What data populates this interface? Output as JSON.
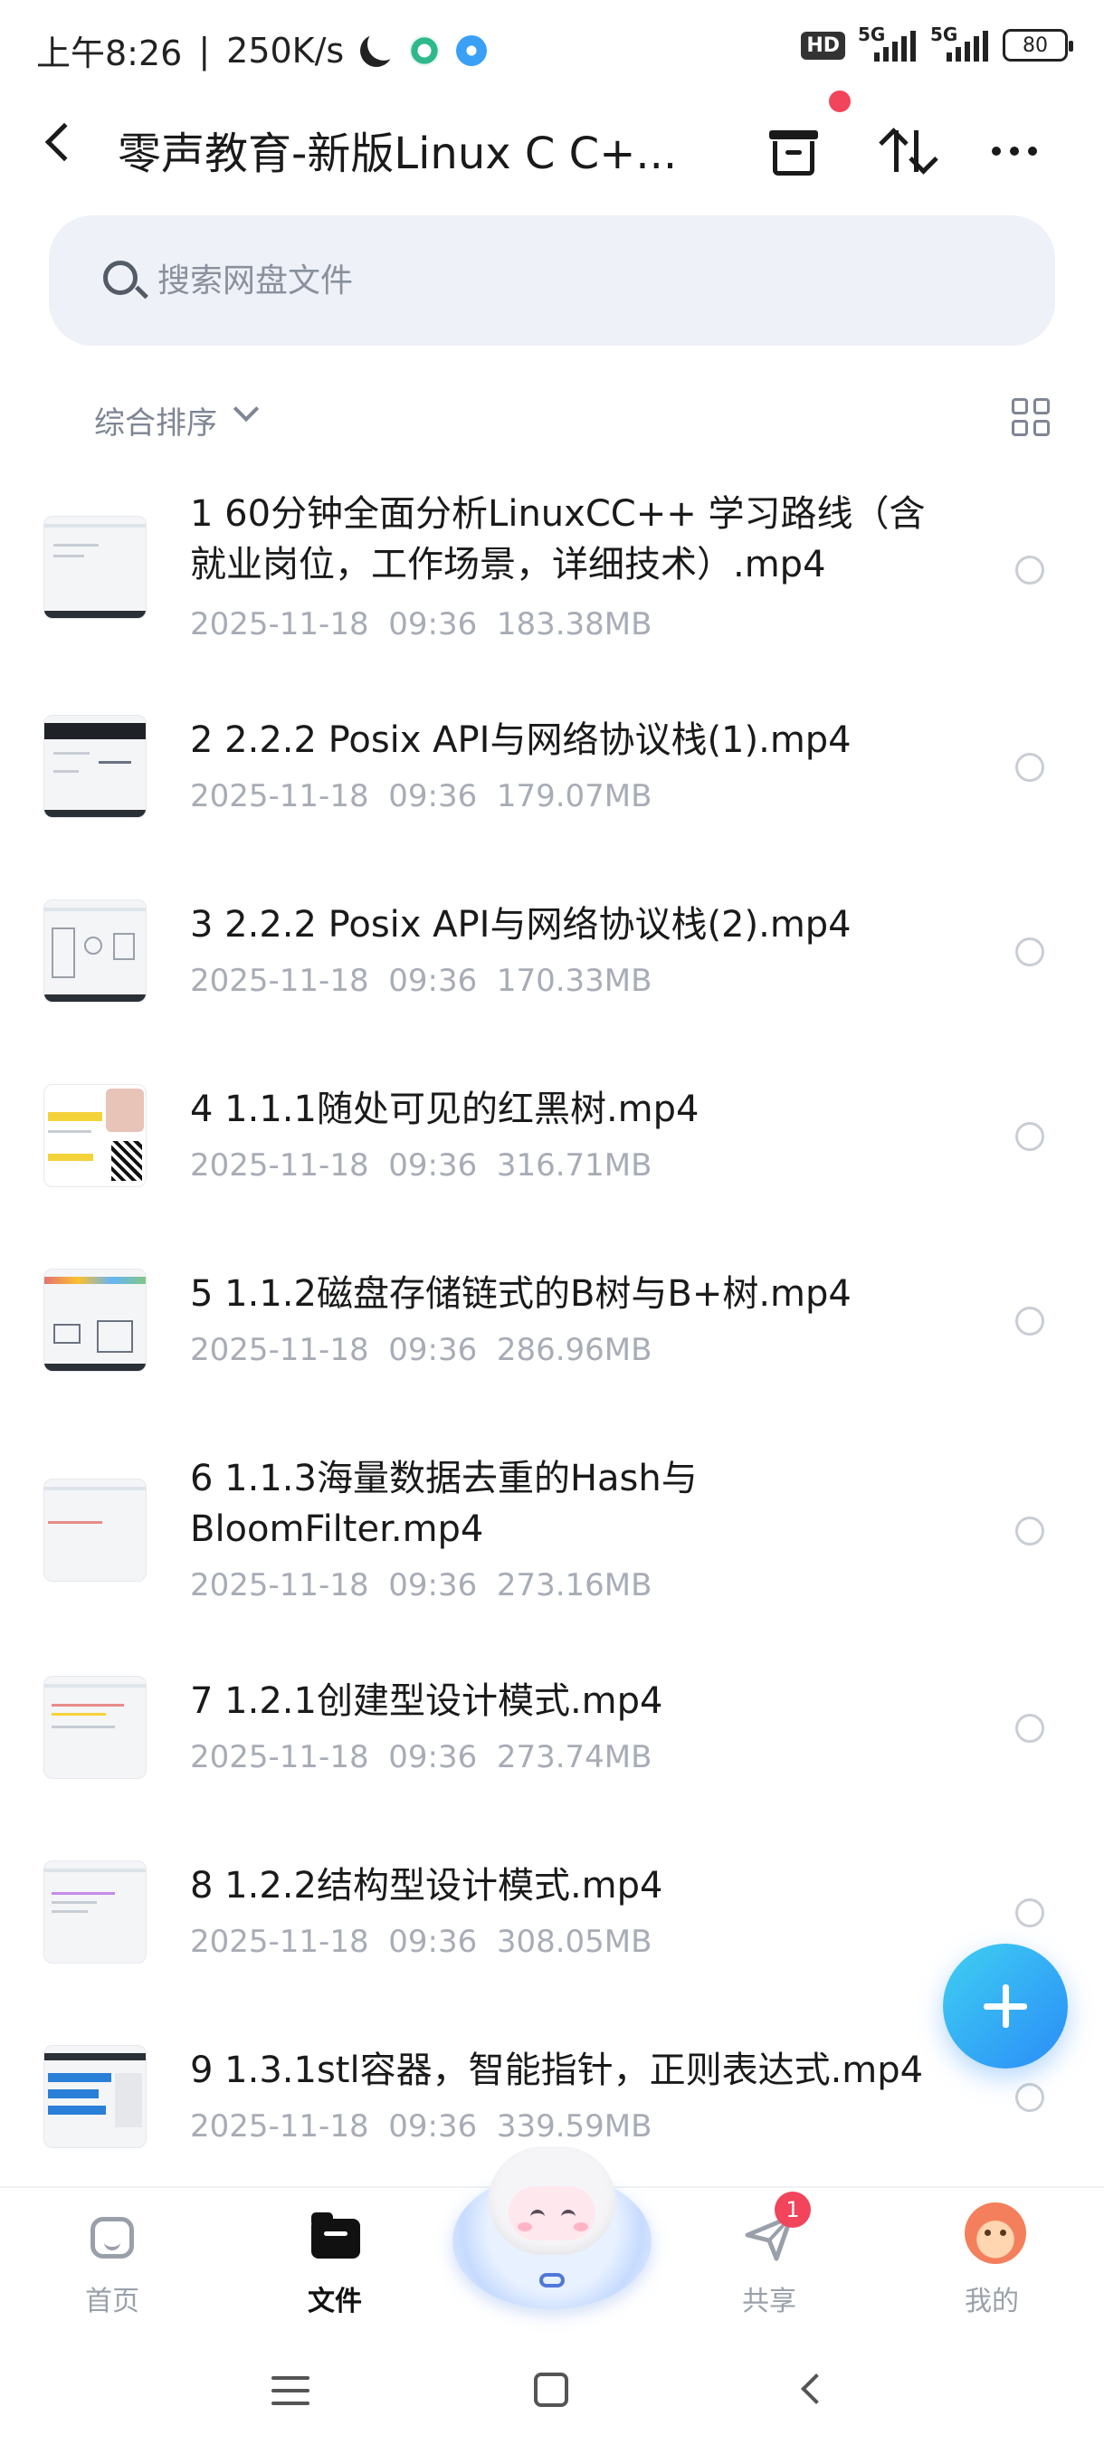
{
  "status_bar": {
    "time": "上午8:26",
    "speed": "250K/s",
    "hd": "HD",
    "network_1": "5G",
    "network_2": "5G",
    "battery": "80"
  },
  "nav": {
    "title": "零声教育-新版Linux C C+...",
    "back_icon": "back-arrow-icon",
    "archive_icon": "archive-box-icon",
    "sort_icon": "sort-arrows-icon",
    "more_icon": "more-dots-icon"
  },
  "search": {
    "placeholder": "搜索网盘文件",
    "value": ""
  },
  "sort": {
    "label": "综合排序"
  },
  "files": [
    {
      "name": "1 60分钟全面分析LinuxCC++ 学习路线（含就业岗位，工作场景，详细技术）.mp4",
      "date": "2025-11-18",
      "time": "09:36",
      "size": "183.38MB"
    },
    {
      "name": "2 2.2.2 Posix API与网络协议栈(1).mp4",
      "date": "2025-11-18",
      "time": "09:36",
      "size": "179.07MB"
    },
    {
      "name": "3 2.2.2 Posix API与网络协议栈(2).mp4",
      "date": "2025-11-18",
      "time": "09:36",
      "size": "170.33MB"
    },
    {
      "name": "4 1.1.1随处可见的红黑树.mp4",
      "date": "2025-11-18",
      "time": "09:36",
      "size": "316.71MB"
    },
    {
      "name": "5 1.1.2磁盘存储链式的B树与B+树.mp4",
      "date": "2025-11-18",
      "time": "09:36",
      "size": "286.96MB"
    },
    {
      "name": "6 1.1.3海量数据去重的Hash与BloomFilter.mp4",
      "date": "2025-11-18",
      "time": "09:36",
      "size": "273.16MB"
    },
    {
      "name": "7 1.2.1创建型设计模式.mp4",
      "date": "2025-11-18",
      "time": "09:36",
      "size": "273.74MB"
    },
    {
      "name": "8 1.2.2结构型设计模式.mp4",
      "date": "2025-11-18",
      "time": "09:36",
      "size": "308.05MB"
    },
    {
      "name": "9 1.3.1stl容器，智能指针，正则表达式.mp4",
      "date": "2025-11-18",
      "time": "09:36",
      "size": "339.59MB"
    }
  ],
  "tabs": [
    {
      "label": "首页",
      "icon": "home-icon"
    },
    {
      "label": "文件",
      "icon": "folder-icon"
    },
    {
      "label": "共享",
      "icon": "send-plane-icon",
      "badge": "1"
    },
    {
      "label": "我的",
      "icon": "avatar-icon"
    }
  ],
  "colors": {
    "accent": "#2a8cf7",
    "badge": "#f2445a",
    "search_bg": "#eef1f7"
  }
}
